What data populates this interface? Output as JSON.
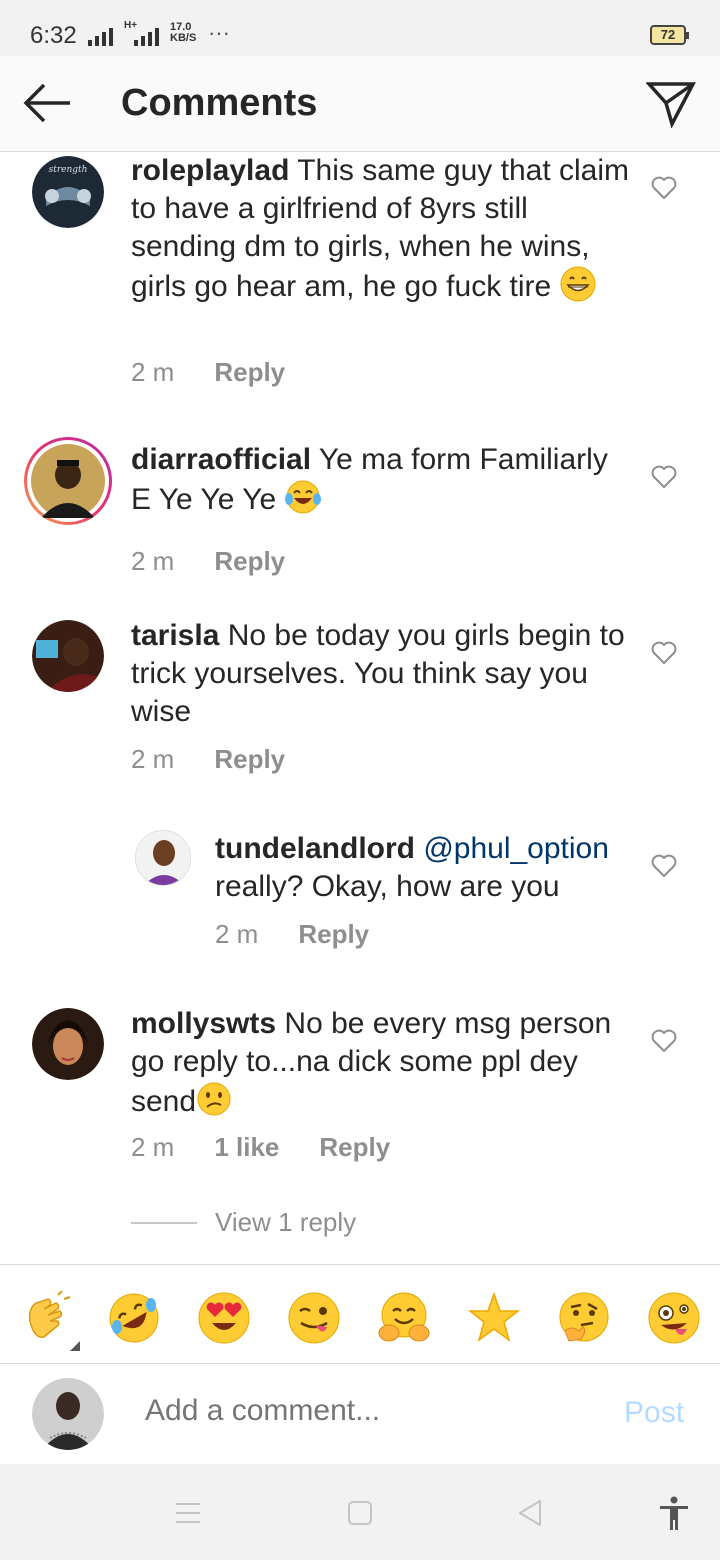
{
  "status_bar": {
    "time": "6:32",
    "network_speed_value": "17.0",
    "network_speed_unit": "KB/S",
    "network_type": "H+",
    "dots": "···",
    "battery": "72"
  },
  "header": {
    "title": "Comments"
  },
  "comments": [
    {
      "username": "roleplaylad",
      "text": "This same guy that claim to have a girlfriend of 8yrs still sending dm to girls, when he wins, girls go hear am, he go fuck tire",
      "time": "2 m",
      "reply_label": "Reply"
    },
    {
      "username": "diarraofficial",
      "text": "Ye ma form Familiarly E Ye Ye Ye",
      "time": "2 m",
      "reply_label": "Reply"
    },
    {
      "username": "tarisla",
      "text": "No be today you girls begin to trick yourselves. You think say you wise",
      "time": "2 m",
      "reply_label": "Reply"
    },
    {
      "username": "tundelandlord",
      "mention": "@phul_option",
      "text": "really? Okay, how are you",
      "time": "2 m",
      "reply_label": "Reply"
    },
    {
      "username": "mollyswts",
      "text": "No be every msg person go reply to...na dick some ppl dey send",
      "time": "2 m",
      "likes": "1 like",
      "reply_label": "Reply"
    }
  ],
  "view_replies": "View 1 reply",
  "emoji_bar": [
    "clapping-hands",
    "rolling-on-floor-laughing",
    "heart-eyes",
    "winking-tongue",
    "hugging",
    "star",
    "thinking",
    "zany-face"
  ],
  "compose": {
    "placeholder": "Add a comment...",
    "post_label": "Post"
  },
  "colors": {
    "accent": "#0095f6",
    "post_disabled": "#b3dbff",
    "secondary_text": "#8e8e8e",
    "mention": "#003569"
  }
}
